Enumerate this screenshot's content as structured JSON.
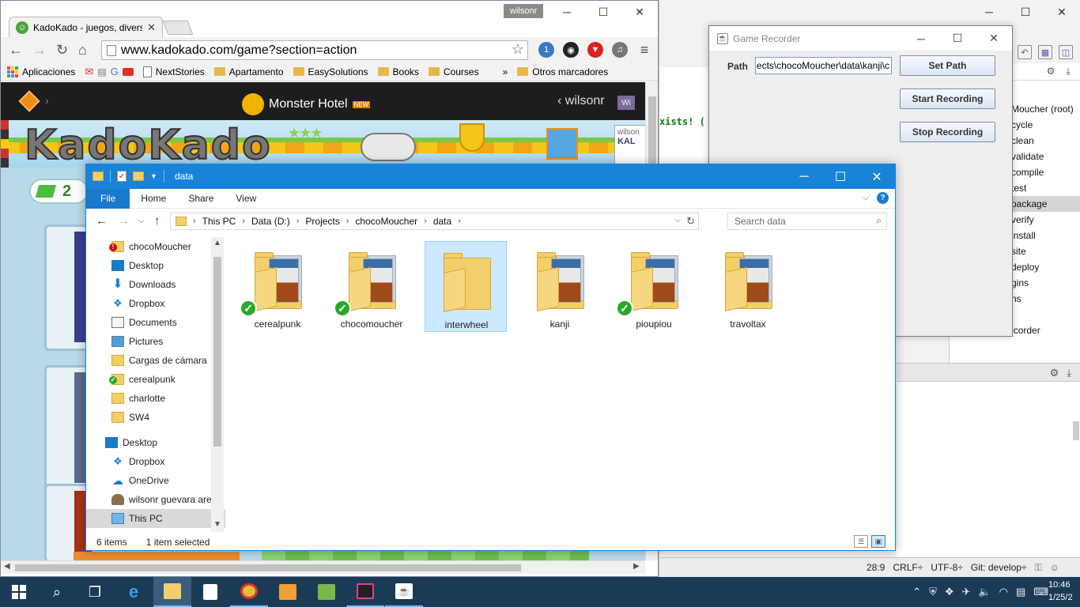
{
  "ide": {
    "code_text": "xists! (",
    "maven_items": [
      "Moucher (root)",
      "cycle",
      "clean",
      "validate",
      "compile",
      "test",
      "package",
      "verify",
      "install",
      "site",
      "deploy",
      "gins",
      "ns",
      "",
      "gamerecorder"
    ],
    "selected_index": 6,
    "status": {
      "position": "28:9",
      "line_sep": "CRLF÷",
      "encoding": "UTF-8÷",
      "git": "Git: develop÷"
    }
  },
  "chrome": {
    "tab_title": "KadoKado - juegos, divers",
    "profile": "wilsonr",
    "url": "www.kadokado.com/game?section=action",
    "bookmarks": [
      {
        "label": "Aplicaciones",
        "type": "apps"
      },
      {
        "label": "",
        "type": "icons"
      },
      {
        "label": "NextStories",
        "type": "page"
      },
      {
        "label": "Apartamento",
        "type": "folder"
      },
      {
        "label": "EasySolutions",
        "type": "folder"
      },
      {
        "label": "Books",
        "type": "folder"
      },
      {
        "label": "Courses",
        "type": "folder"
      }
    ],
    "more": "»",
    "other_bookmarks": "Otros marcadores",
    "ext_badge": "1"
  },
  "kadokado": {
    "game_title": "Monster Hotel",
    "new_badge": "NEW",
    "user": "wilsonr",
    "avatar": "Wi",
    "logo": "KadoKado",
    "gems": "2",
    "side_user": "wilson",
    "side_label": "KAL"
  },
  "recorder": {
    "title": "Game Recorder",
    "path_label": "Path",
    "path_value": "ects\\chocoMoucher\\data\\kanji\\c",
    "set_path": "Set Path",
    "start": "Start Recording",
    "stop": "Stop Recording"
  },
  "explorer": {
    "title": "data",
    "ribbon_tabs": [
      "File",
      "Home",
      "Share",
      "View"
    ],
    "breadcrumb": [
      "This PC",
      "Data (D:)",
      "Projects",
      "chocoMoucher",
      "data"
    ],
    "search_placeholder": "Search data",
    "nav_items": [
      {
        "label": "chocoMoucher",
        "icon": "folder-err",
        "pinned": true
      },
      {
        "label": "Desktop",
        "icon": "desktop",
        "pinned": true
      },
      {
        "label": "Downloads",
        "icon": "down",
        "pinned": true
      },
      {
        "label": "Dropbox",
        "icon": "dropbox",
        "pinned": true
      },
      {
        "label": "Documents",
        "icon": "docs",
        "pinned": true
      },
      {
        "label": "Pictures",
        "icon": "pics",
        "pinned": true
      },
      {
        "label": "Cargas de cámara",
        "icon": "camera",
        "pinned": false
      },
      {
        "label": "cerealpunk",
        "icon": "folder-ok",
        "pinned": false
      },
      {
        "label": "charlotte",
        "icon": "folder",
        "pinned": false
      },
      {
        "label": "SW4",
        "icon": "folder",
        "pinned": false
      },
      {
        "label": "Desktop",
        "icon": "desktop",
        "pinned": false,
        "top": true
      },
      {
        "label": "Dropbox",
        "icon": "dropbox",
        "pinned": false
      },
      {
        "label": "OneDrive",
        "icon": "onedrive",
        "pinned": false
      },
      {
        "label": "wilsonr guevara arev",
        "icon": "user",
        "pinned": false
      },
      {
        "label": "This PC",
        "icon": "pc",
        "pinned": false,
        "selected": true
      }
    ],
    "files": [
      {
        "name": "cerealpunk",
        "synced": true,
        "selected": false,
        "empty": false
      },
      {
        "name": "chocomoucher",
        "synced": true,
        "selected": false,
        "empty": false
      },
      {
        "name": "interwheel",
        "synced": false,
        "selected": true,
        "empty": true
      },
      {
        "name": "kanji",
        "synced": false,
        "selected": false,
        "empty": false
      },
      {
        "name": "pioupiou",
        "synced": true,
        "selected": false,
        "empty": false
      },
      {
        "name": "travoltax",
        "synced": false,
        "selected": false,
        "empty": false
      }
    ],
    "status_count": "6 items",
    "status_selected": "1 item selected"
  },
  "taskbar": {
    "time": "10:46",
    "date": "1/25/2"
  }
}
